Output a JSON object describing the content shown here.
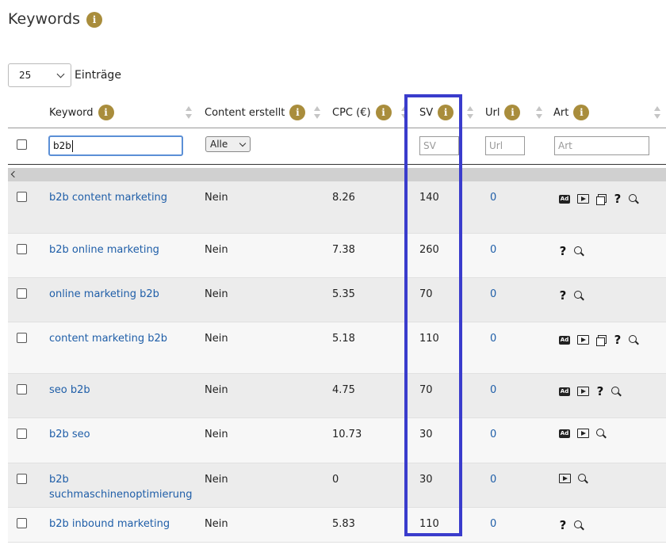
{
  "page": {
    "title": "Keywords",
    "info_glyph": "i"
  },
  "length_menu": {
    "value": "25",
    "label": "Einträge"
  },
  "columns": {
    "keyword": "Keyword",
    "content": "Content erstellt",
    "cpc": "CPC (€)",
    "sv": "SV",
    "url": "Url",
    "art": "Art"
  },
  "filters": {
    "keyword_value": "b2b",
    "content_value": "Alle",
    "sv_placeholder": "SV",
    "url_placeholder": "Url",
    "art_placeholder": "Art"
  },
  "icon_labels": {
    "ad": "Ad",
    "question": "?"
  },
  "rows": [
    {
      "keyword": "b2b content marketing",
      "content": "Nein",
      "cpc": "8.26",
      "sv": "140",
      "url": "0",
      "art": [
        "ad-icon",
        "video-icon",
        "images-icon",
        "question-icon",
        "search-icon"
      ]
    },
    {
      "keyword": "b2b online marketing",
      "content": "Nein",
      "cpc": "7.38",
      "sv": "260",
      "url": "0",
      "art": [
        "question-icon",
        "search-icon"
      ]
    },
    {
      "keyword": "online marketing b2b",
      "content": "Nein",
      "cpc": "5.35",
      "sv": "70",
      "url": "0",
      "art": [
        "question-icon",
        "search-icon"
      ]
    },
    {
      "keyword": "content marketing b2b",
      "content": "Nein",
      "cpc": "5.18",
      "sv": "110",
      "url": "0",
      "art": [
        "ad-icon",
        "video-icon",
        "images-icon",
        "question-icon",
        "search-icon"
      ]
    },
    {
      "keyword": "seo b2b",
      "content": "Nein",
      "cpc": "4.75",
      "sv": "70",
      "url": "0",
      "art": [
        "ad-icon",
        "video-icon",
        "question-icon",
        "search-icon"
      ]
    },
    {
      "keyword": "b2b seo",
      "content": "Nein",
      "cpc": "10.73",
      "sv": "30",
      "url": "0",
      "art": [
        "ad-icon",
        "video-icon",
        "search-icon"
      ]
    },
    {
      "keyword": "b2b suchmaschinenoptimierung",
      "content": "Nein",
      "cpc": "0",
      "sv": "30",
      "url": "0",
      "art": [
        "video-icon",
        "search-icon"
      ]
    },
    {
      "keyword": "b2b inbound marketing",
      "content": "Nein",
      "cpc": "5.83",
      "sv": "110",
      "url": "0",
      "art": [
        "question-icon",
        "search-icon"
      ]
    }
  ],
  "colors": {
    "info_badge": "#a98d3c",
    "link": "#1f5ea8",
    "highlight": "#3a3ccc",
    "focus": "#5b8fd6"
  }
}
